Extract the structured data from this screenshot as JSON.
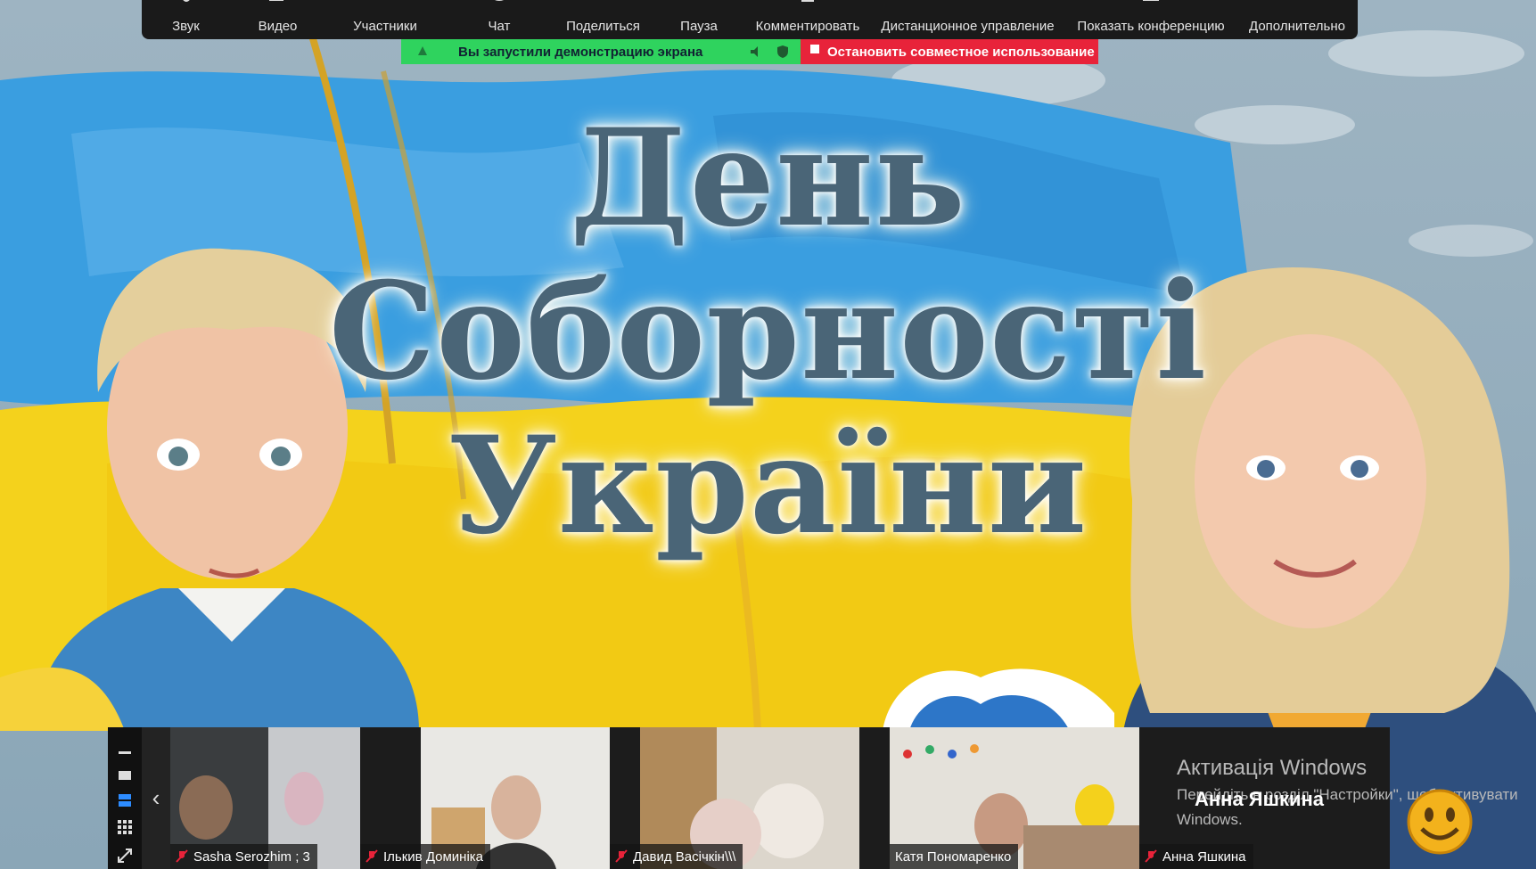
{
  "toolbar": {
    "items": [
      {
        "label": "Звук",
        "icon": "microphone-icon"
      },
      {
        "label": "Видео",
        "icon": "video-camera-icon"
      },
      {
        "label": "Участники",
        "icon": "participants-icon"
      },
      {
        "label": "Чат",
        "icon": "chat-icon"
      },
      {
        "label": "Поделиться",
        "icon": "share-screen-icon"
      },
      {
        "label": "Пауза",
        "icon": "pause-icon"
      },
      {
        "label": "Комментировать",
        "icon": "annotate-icon"
      },
      {
        "label": "Дистанционное управление",
        "icon": "remote-control-icon"
      },
      {
        "label": "Показать конференцию",
        "icon": "show-meeting-icon"
      },
      {
        "label": "Дополнительно",
        "icon": "more-icon"
      }
    ]
  },
  "share_banner": {
    "status": "Вы запустили демонстрацию экрана",
    "stop": "Остановить совместное использование",
    "green": "#2fd35e",
    "red": "#e8233a"
  },
  "slide": {
    "line1": "День",
    "line2": "Соборності",
    "line3": "України"
  },
  "participants": [
    {
      "name": "Sasha Serozhim ; 3",
      "muted": true
    },
    {
      "name": "Ількив Доминіка",
      "muted": true
    },
    {
      "name": "Давид Васічкін\\\\\\",
      "muted": true
    },
    {
      "name": "Катя Пономаренко",
      "muted": false
    },
    {
      "name": "Анна Яшкина",
      "muted": true
    }
  ],
  "active_speaker": "Анна Яшкина",
  "windows_activation": {
    "title": "Активація Windows",
    "line": "Перейдіть в розділ \"Настройки\", щоб активувати",
    "line2": "Windows."
  }
}
